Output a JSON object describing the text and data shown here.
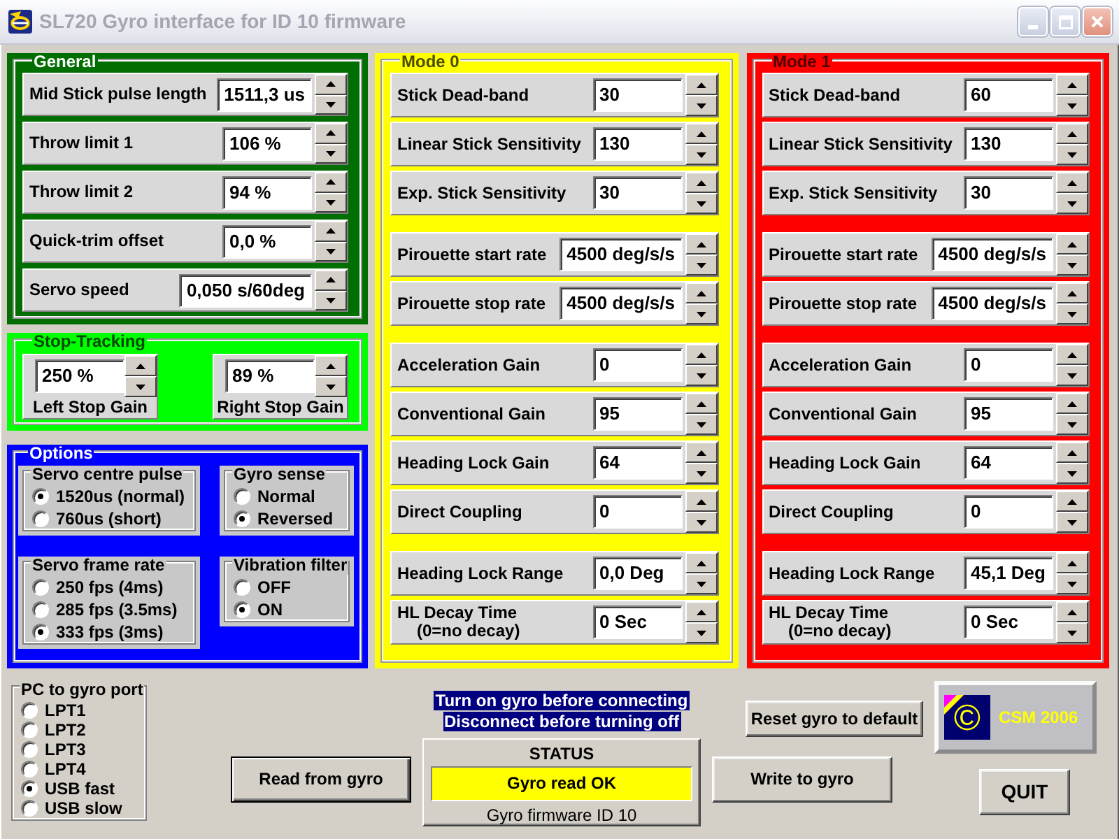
{
  "window": {
    "title": "SL720 Gyro interface for ID 10 firmware"
  },
  "general": {
    "title": "General",
    "rows": [
      {
        "label": "Mid Stick pulse length",
        "value": "1511,3 us"
      },
      {
        "label": "Throw limit 1",
        "value": "106 %"
      },
      {
        "label": "Throw limit 2",
        "value": "94 %"
      },
      {
        "label": "Quick-trim offset",
        "value": "0,0 %"
      },
      {
        "label": "Servo speed",
        "value": "0,050 s/60deg"
      }
    ]
  },
  "stop_tracking": {
    "title": "Stop-Tracking",
    "gains": [
      {
        "label": "Left Stop Gain",
        "value": "250 %"
      },
      {
        "label": "Right Stop Gain",
        "value": "89 %"
      }
    ]
  },
  "options": {
    "title": "Options",
    "groups": [
      {
        "title": "Servo centre pulse",
        "choices": [
          {
            "label": "1520us (normal)",
            "selected": true
          },
          {
            "label": "760us (short)",
            "selected": false
          }
        ]
      },
      {
        "title": "Gyro sense",
        "choices": [
          {
            "label": "Normal",
            "selected": false
          },
          {
            "label": "Reversed",
            "selected": true
          }
        ]
      },
      {
        "title": "Servo frame rate",
        "choices": [
          {
            "label": "250 fps (4ms)",
            "selected": false
          },
          {
            "label": "285 fps (3.5ms)",
            "selected": false
          },
          {
            "label": "333 fps (3ms)",
            "selected": true
          }
        ]
      },
      {
        "title": "Vibration filter",
        "choices": [
          {
            "label": "OFF",
            "selected": false
          },
          {
            "label": "ON",
            "selected": true
          }
        ]
      }
    ]
  },
  "modes": [
    {
      "title": "Mode 0",
      "color": "#ffff00",
      "sections": [
        {
          "rows": [
            {
              "label": "Stick Dead-band",
              "value": "30"
            },
            {
              "label": "Linear Stick Sensitivity",
              "value": "130"
            },
            {
              "label": "Exp. Stick Sensitivity",
              "value": "30"
            }
          ]
        },
        {
          "rows": [
            {
              "label": "Pirouette start rate",
              "value": "4500 deg/s/s"
            },
            {
              "label": "Pirouette stop rate",
              "value": "4500 deg/s/s"
            }
          ]
        },
        {
          "rows": [
            {
              "label": "Acceleration Gain",
              "value": "0"
            },
            {
              "label": "Conventional Gain",
              "value": "95"
            },
            {
              "label": "Heading Lock Gain",
              "value": "64"
            },
            {
              "label": "Direct Coupling",
              "value": "0"
            }
          ]
        },
        {
          "rows": [
            {
              "label": "Heading Lock Range",
              "value": "0,0 Deg"
            },
            {
              "label": "HL Decay Time",
              "note": "(0=no decay)",
              "value": "0 Sec"
            }
          ]
        }
      ]
    },
    {
      "title": "Mode 1",
      "color": "#ff0000",
      "sections": [
        {
          "rows": [
            {
              "label": "Stick Dead-band",
              "value": "60"
            },
            {
              "label": "Linear Stick Sensitivity",
              "value": "130"
            },
            {
              "label": "Exp. Stick Sensitivity",
              "value": "30"
            }
          ]
        },
        {
          "rows": [
            {
              "label": "Pirouette start rate",
              "value": "4500 deg/s/s"
            },
            {
              "label": "Pirouette stop rate",
              "value": "4500 deg/s/s"
            }
          ]
        },
        {
          "rows": [
            {
              "label": "Acceleration Gain",
              "value": "0"
            },
            {
              "label": "Conventional Gain",
              "value": "95"
            },
            {
              "label": "Heading Lock Gain",
              "value": "64"
            },
            {
              "label": "Direct Coupling",
              "value": "0"
            }
          ]
        },
        {
          "rows": [
            {
              "label": "Heading Lock Range",
              "value": "45,1 Deg"
            },
            {
              "label": "HL Decay Time",
              "note": "(0=no decay)",
              "value": "0 Sec"
            }
          ]
        }
      ]
    }
  ],
  "port": {
    "title": "PC to gyro port",
    "choices": [
      {
        "label": "LPT1",
        "selected": false
      },
      {
        "label": "LPT2",
        "selected": false
      },
      {
        "label": "LPT3",
        "selected": false
      },
      {
        "label": "LPT4",
        "selected": false
      },
      {
        "label": "USB fast",
        "selected": true
      },
      {
        "label": "USB slow",
        "selected": false
      }
    ]
  },
  "read_button": {
    "label": "Read from gyro",
    "default": true
  },
  "notices": [
    "Turn on gyro before connecting",
    "Disconnect before turning off"
  ],
  "status": {
    "title": "STATUS",
    "message": "Gyro read OK",
    "firmware": "Gyro firmware ID 10"
  },
  "reset_button": {
    "label": "Reset gyro to default",
    "default": false
  },
  "write_button": {
    "label": "Write to gyro",
    "default": false
  },
  "logo": {
    "symbol": "©",
    "text": "CSM 2006"
  },
  "quit_button": {
    "label": "QUIT",
    "default": false
  }
}
